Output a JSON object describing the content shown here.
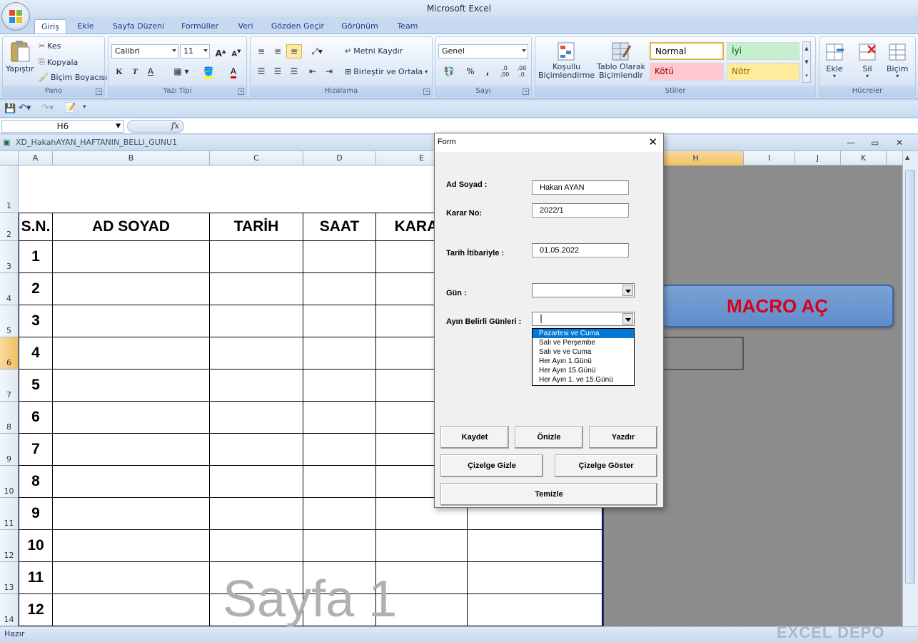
{
  "app": {
    "title": "Microsoft Excel"
  },
  "tabs": [
    "Giriş",
    "Ekle",
    "Sayfa Düzeni",
    "Formüller",
    "Veri",
    "Gözden Geçir",
    "Görünüm",
    "Team"
  ],
  "ribbon": {
    "pano": {
      "title": "Pano",
      "paste": "Yapıştır",
      "cut": "Kes",
      "copy": "Kopyala",
      "format_painter": "Biçim Boyacısı"
    },
    "yazi_tipi": {
      "title": "Yazı Tipi",
      "font": "Calibri",
      "size": "11",
      "bold": "K",
      "italic": "T",
      "underline": "A"
    },
    "hizalama": {
      "title": "Hizalama",
      "wrap": "Metni Kaydır",
      "merge": "Birleştir ve Ortala"
    },
    "sayi": {
      "title": "Sayı",
      "format": "Genel",
      "percent": "%",
      "comma": ",",
      "inc": ",0 ,00",
      "dec": ",00 ,0"
    },
    "stiller": {
      "title": "Stiller",
      "cond": "Koşullu\nBiçimlendirme",
      "table": "Tablo Olarak\nBiçimlendir",
      "normal": "Normal",
      "iyi": "İyi",
      "kotu": "Kötü",
      "notr": "Nötr"
    },
    "hucreler": {
      "title": "Hücreler",
      "ekle": "Ekle",
      "sil": "Sil",
      "bicim": "Biçim"
    }
  },
  "formula_bar": {
    "name_box": "H6",
    "fx": "fx",
    "value": ""
  },
  "workbook": {
    "title": "XD_HakahAYAN_HAFTANIN_BELLI_GUNU1"
  },
  "columns": [
    "A",
    "B",
    "C",
    "D",
    "E",
    "H",
    "I",
    "J",
    "K"
  ],
  "rows": [
    "1",
    "2",
    "3",
    "4",
    "5",
    "6",
    "7",
    "8",
    "9",
    "10",
    "11",
    "12",
    "13",
    "14"
  ],
  "table": {
    "headers": [
      "S.N.",
      "AD SOYAD",
      "TARİH",
      "SAAT",
      "KARAR"
    ],
    "numbers": [
      "1",
      "2",
      "3",
      "4",
      "5",
      "6",
      "7",
      "8",
      "9",
      "10",
      "11",
      "12"
    ]
  },
  "macro_button": "MACRO AÇ",
  "watermark": "Sayfa 1",
  "status": {
    "ready": "Hazır",
    "brand": "EXCEL DEPO"
  },
  "form": {
    "title": "Form",
    "labels": {
      "ad_soyad": "Ad Soyad :",
      "karar_no": "Karar No:",
      "tarih": "Tarih İtibariyle :",
      "gun": "Gün :",
      "belirli": "Ayın Belirli Günleri :"
    },
    "values": {
      "ad_soyad": "Hakan AYAN",
      "karar_no": "2022/1",
      "tarih": "01.05.2022",
      "gun": "",
      "belirli": "|"
    },
    "options": [
      "Pazartesi ve Cuma",
      "Salı ve Perşembe",
      "Salı ve ve Cuma",
      "Her Ayın 1.Günü",
      "Her Ayın 15.Günü",
      "Her Ayın 1. ve 15.Günü"
    ],
    "buttons": {
      "kaydet": "Kaydet",
      "onizle": "Önizle",
      "yazdir": "Yazdır",
      "gizle": "Çizelge Gizle",
      "goster": "Çizelge Göster",
      "temizle": "Temizle"
    }
  }
}
